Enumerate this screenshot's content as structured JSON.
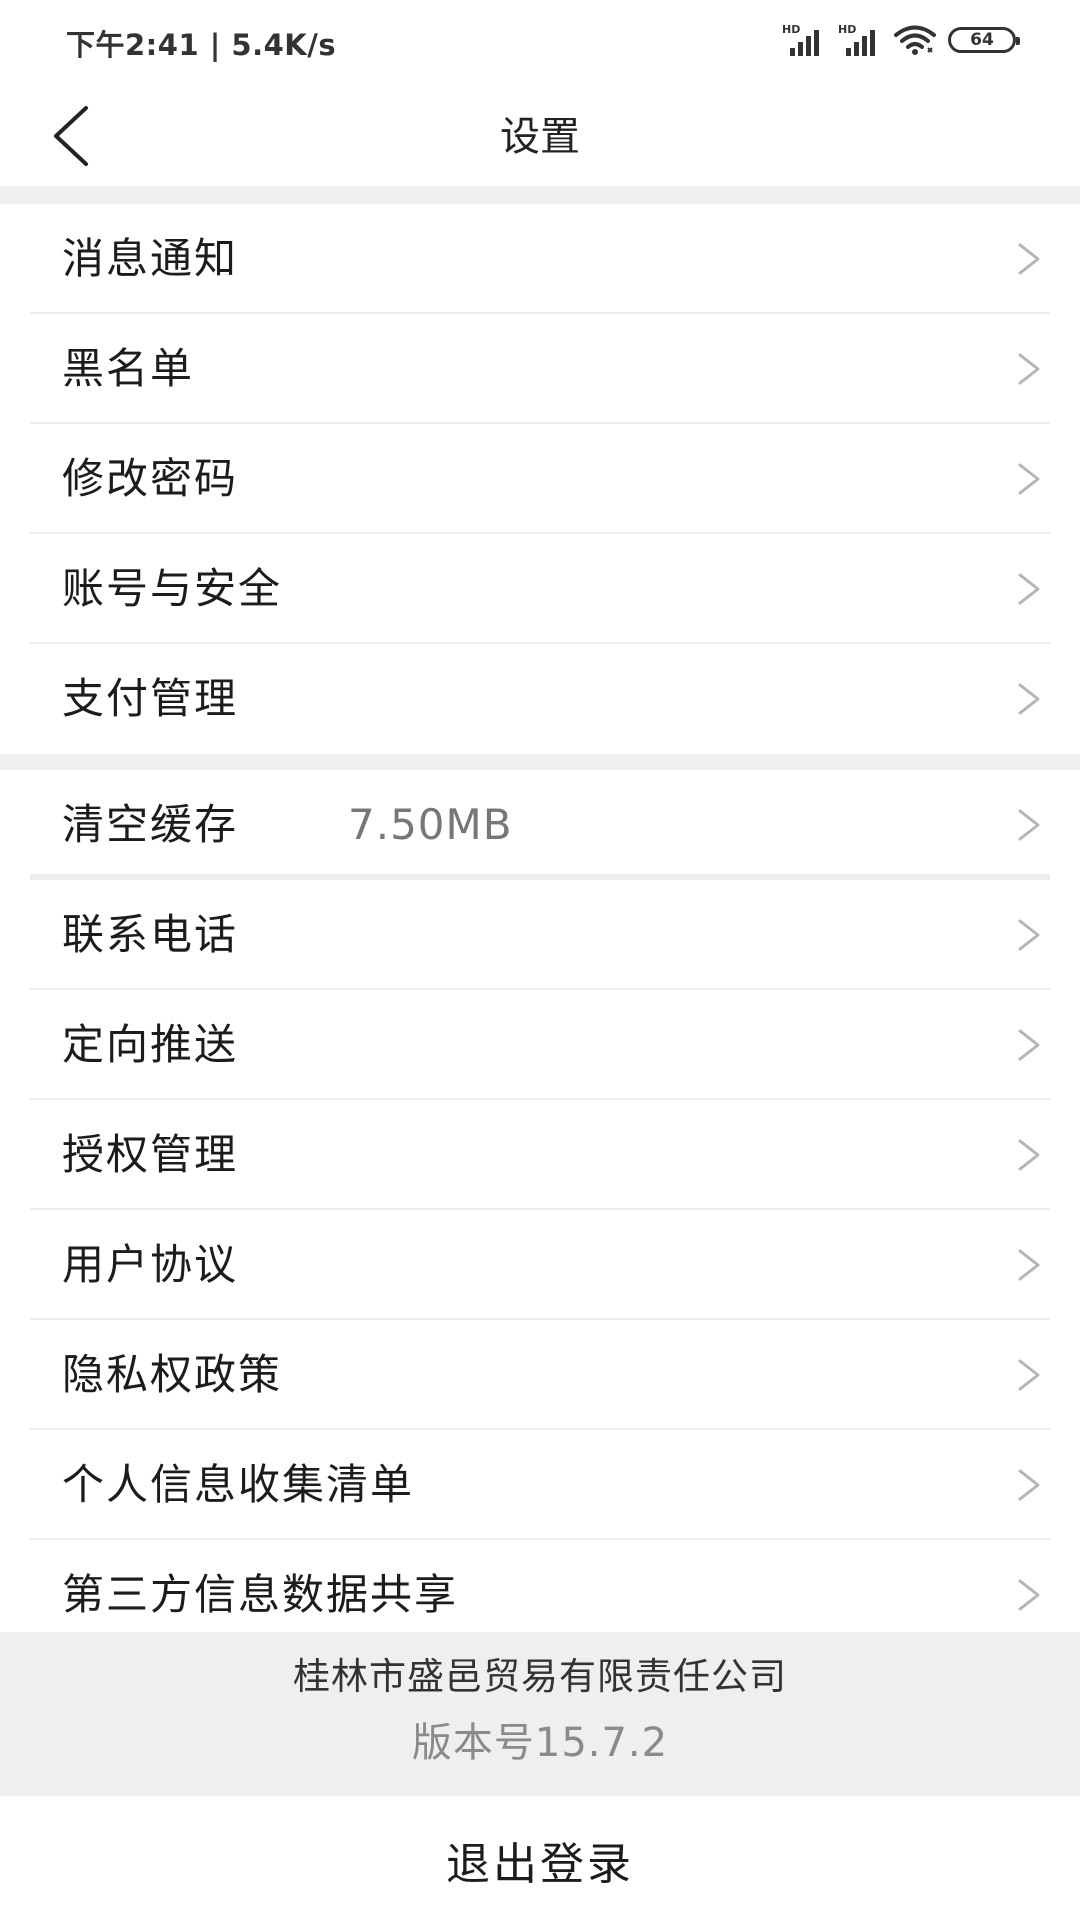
{
  "status_bar": {
    "time_text": "下午2:41 | 5.4K/s",
    "hd_label_1": "HD",
    "hd_label_2": "HD",
    "battery_level": "64"
  },
  "header": {
    "title": "设置"
  },
  "section1": {
    "items": [
      {
        "label": "消息通知"
      },
      {
        "label": "黑名单"
      },
      {
        "label": "修改密码"
      },
      {
        "label": "账号与安全"
      },
      {
        "label": "支付管理"
      }
    ]
  },
  "section2": {
    "items": [
      {
        "label": "清空缓存",
        "value": "7.50MB"
      },
      {
        "label": "联系电话"
      },
      {
        "label": "定向推送"
      },
      {
        "label": "授权管理"
      },
      {
        "label": "用户协议"
      },
      {
        "label": "隐私权政策"
      },
      {
        "label": "个人信息收集清单"
      },
      {
        "label": "第三方信息数据共享"
      }
    ]
  },
  "footer": {
    "company": "桂林市盛邑贸易有限责任公司",
    "version": "版本号15.7.2",
    "logout_label": "退出登录"
  },
  "colors": {
    "background": "#ffffff",
    "section_gap": "#f0f0f0",
    "footer_background": "#efefef",
    "divider": "#ececec",
    "chevron": "#b5b5b5"
  }
}
